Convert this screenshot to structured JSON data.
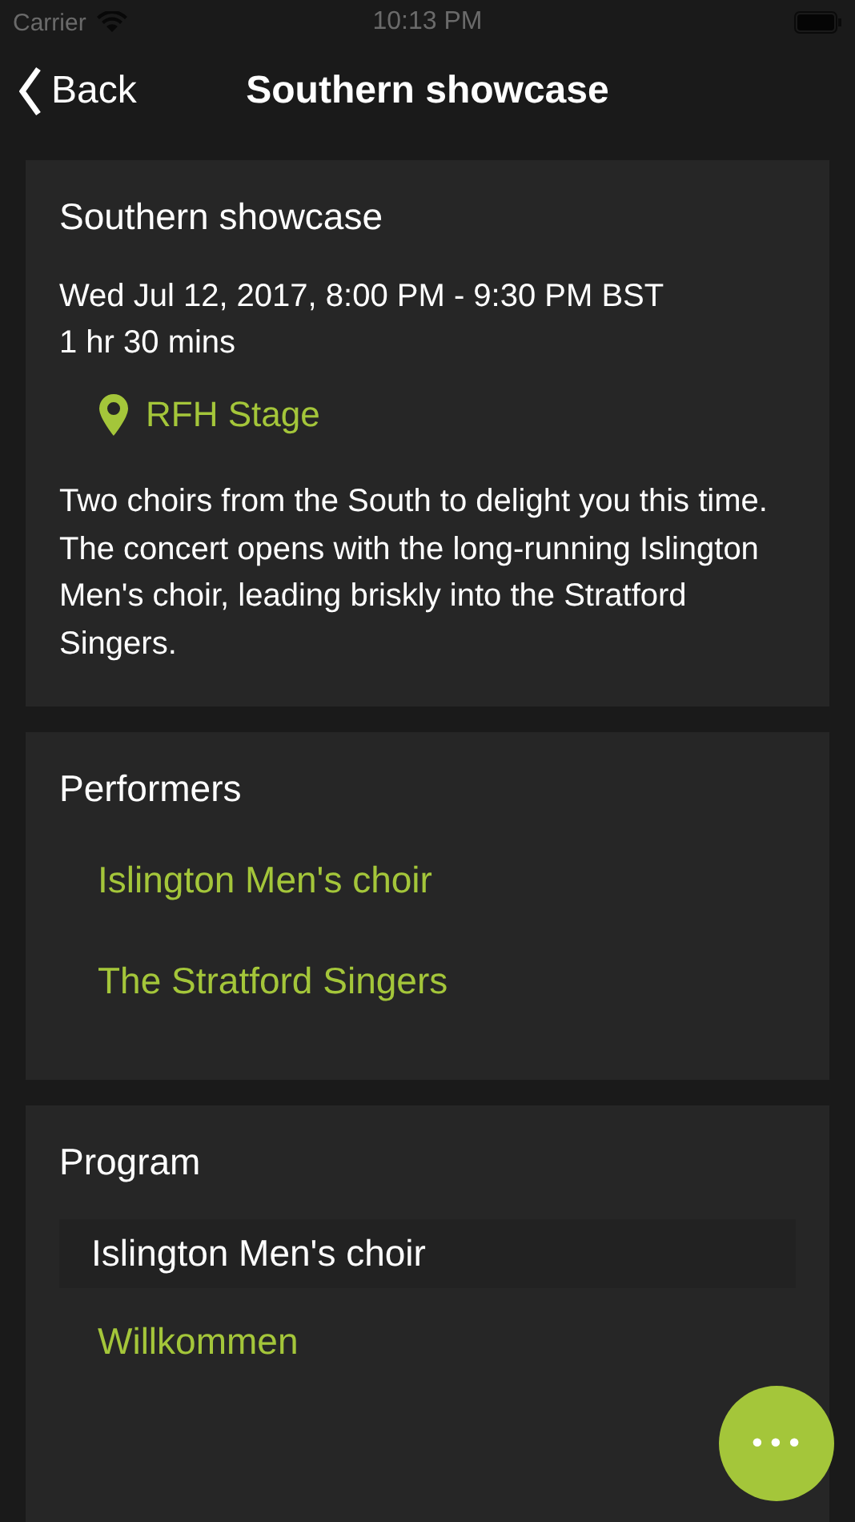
{
  "status_bar": {
    "carrier": "Carrier",
    "time": "10:13 PM"
  },
  "nav": {
    "back": "Back",
    "title": "Southern showcase"
  },
  "event": {
    "title": "Southern showcase",
    "datetime": "Wed Jul 12, 2017, 8:00 PM - 9:30 PM BST",
    "duration": "1 hr 30 mins",
    "venue": "RFH Stage",
    "description": "Two choirs from the South to delight you this time. The concert opens with the long-running Islington Men's choir, leading briskly into the Stratford Singers."
  },
  "performers": {
    "title": "Performers",
    "items": [
      "Islington Men's choir",
      "The Stratford Singers"
    ]
  },
  "program": {
    "title": "Program",
    "groups": [
      {
        "performer": "Islington Men's choir",
        "pieces": [
          "Willkommen"
        ]
      }
    ]
  },
  "fab": {
    "label": "•••"
  }
}
